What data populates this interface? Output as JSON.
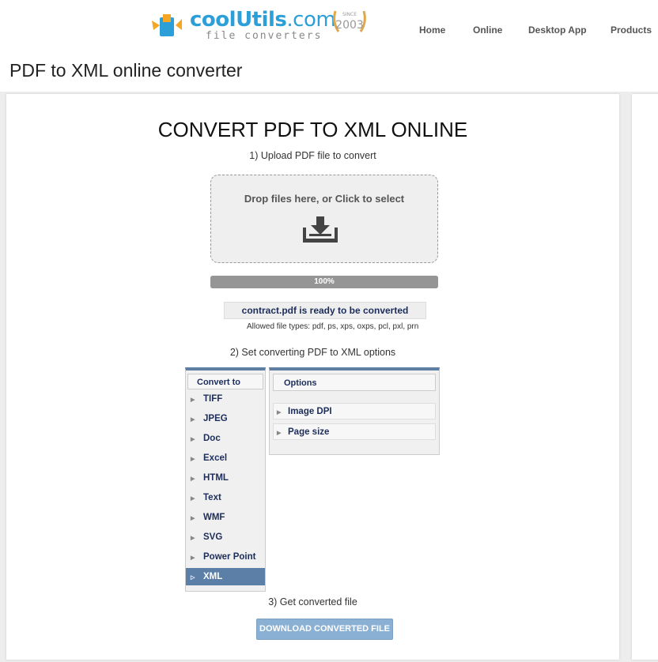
{
  "header": {
    "logo": {
      "name": "CoolUtils.com",
      "tagline": "file converters",
      "badge_since": "SINCE",
      "badge_year": "2003"
    },
    "nav": [
      "Home",
      "Online",
      "Desktop App",
      "Products"
    ]
  },
  "page_title": "PDF to XML online converter",
  "main": {
    "heading": "CONVERT PDF TO XML ONLINE",
    "step1": "1) Upload PDF file to convert",
    "dropzone_text": "Drop files here, or Click to select",
    "progress": {
      "label": "100%",
      "percent": 100
    },
    "status": "contract.pdf is ready to be converted",
    "allowed_types": "Allowed file types: pdf, ps, xps, oxps, pcl, pxl, prn",
    "step2": "2) Set converting PDF to XML options",
    "convert_to": {
      "title": "Convert to",
      "formats": [
        "TIFF",
        "JPEG",
        "Doc",
        "Excel",
        "HTML",
        "Text",
        "WMF",
        "SVG",
        "Power Point",
        "XML"
      ],
      "selected": "XML"
    },
    "options": {
      "title": "Options",
      "items": [
        "Image DPI",
        "Page size"
      ]
    },
    "step3": "3) Get converted file",
    "download_button": "DOWNLOAD CONVERTED FILE"
  },
  "colors": {
    "accent": "#5b7fa6",
    "logo_blue": "#2d9fd8",
    "logo_orange": "#f5a623",
    "text_dark_blue": "#1c2d5a",
    "button": "#8ab0d3"
  }
}
